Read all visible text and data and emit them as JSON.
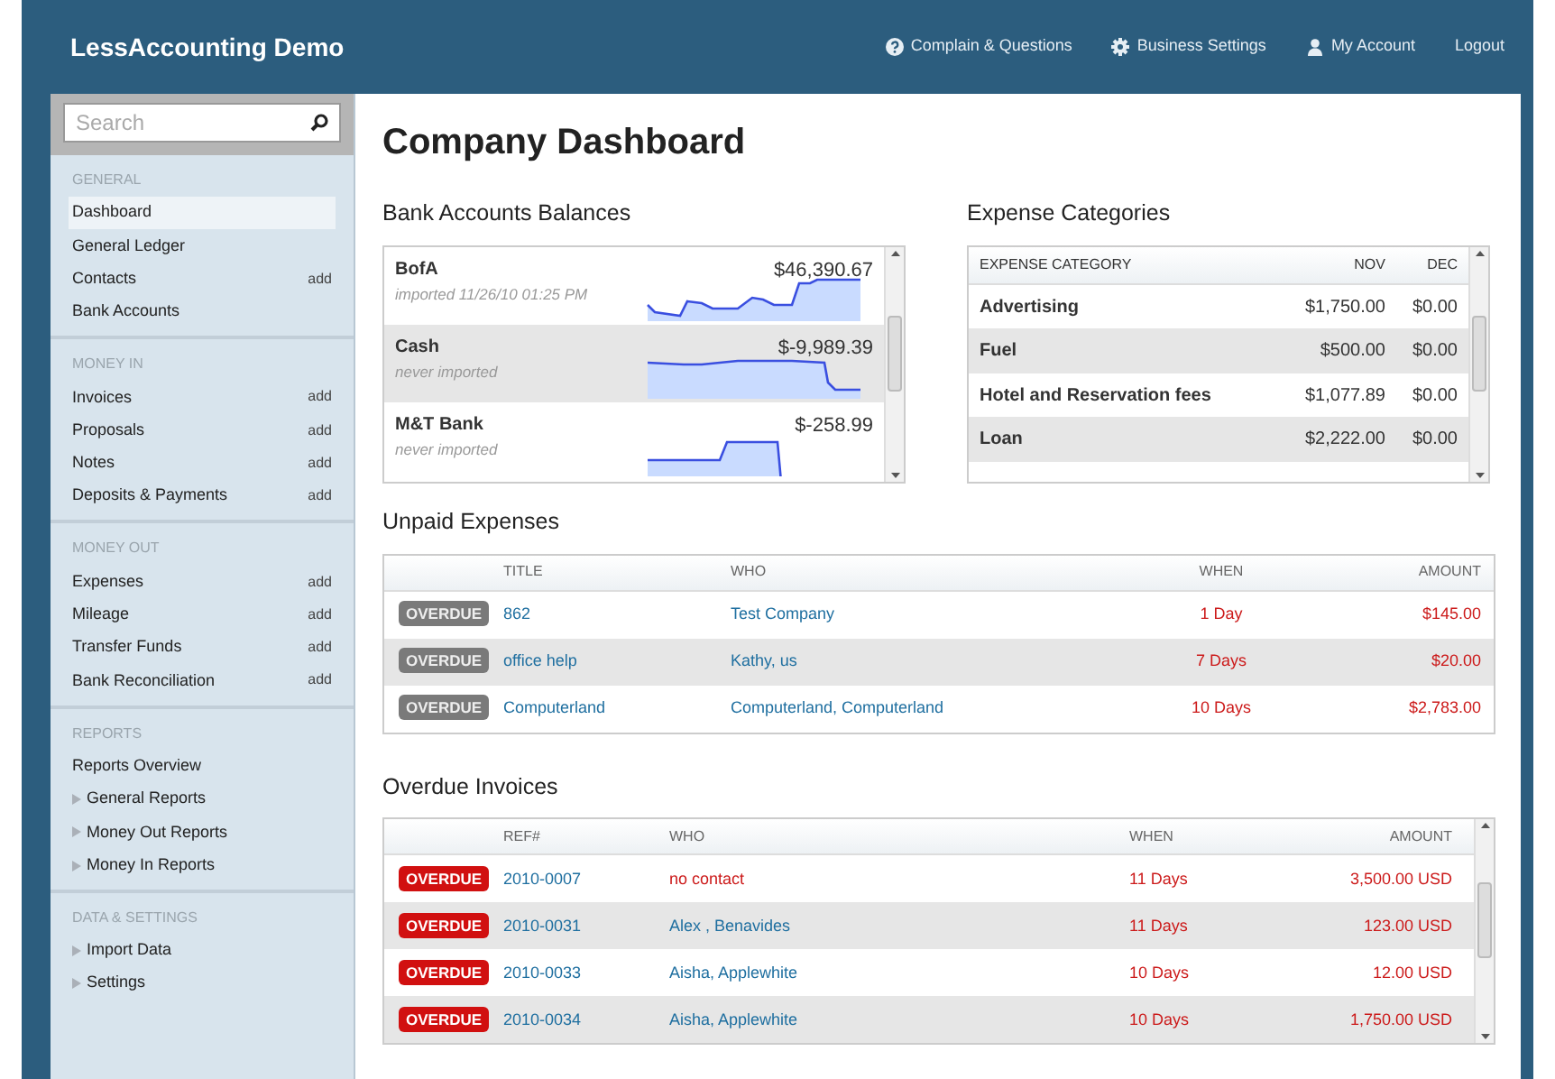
{
  "header": {
    "app_title": "LessAccounting Demo",
    "links": [
      {
        "label": "Complain & Questions",
        "kind": "help"
      },
      {
        "label": "Business Settings",
        "kind": "gear"
      },
      {
        "label": "My Account",
        "kind": "user"
      },
      {
        "label": "Logout",
        "kind": "plain"
      }
    ]
  },
  "sidebar": {
    "search": {
      "placeholder": "Search"
    },
    "sections": [
      {
        "title": "GENERAL",
        "items": [
          {
            "label": "Dashboard",
            "selected": true
          },
          {
            "label": "General Ledger",
            "selected": false
          },
          {
            "label": "Contacts",
            "selected": false,
            "add": "add"
          },
          {
            "label": "Bank Accounts",
            "selected": false
          }
        ]
      },
      {
        "title": "MONEY IN",
        "items": [
          {
            "label": "Invoices",
            "selected": false,
            "add": "add"
          },
          {
            "label": "Proposals",
            "selected": false,
            "add": "add"
          },
          {
            "label": "Notes",
            "selected": false,
            "add": "add"
          },
          {
            "label": "Deposits & Payments",
            "selected": false,
            "add": "add"
          }
        ]
      },
      {
        "title": "MONEY OUT",
        "items": [
          {
            "label": "Expenses",
            "selected": false,
            "add": "add"
          },
          {
            "label": "Mileage",
            "selected": false,
            "add": "add"
          },
          {
            "label": "Transfer Funds",
            "selected": false,
            "add": "add"
          },
          {
            "label": "Bank Reconciliation",
            "selected": false,
            "add": "add"
          }
        ]
      },
      {
        "title": "REPORTS",
        "items": [
          {
            "label": "Reports Overview",
            "selected": false
          },
          {
            "label": "General Reports",
            "selected": false,
            "expanded": false
          },
          {
            "label": "Money Out Reports",
            "selected": false,
            "expanded": false
          },
          {
            "label": "Money In Reports",
            "selected": false,
            "expanded": false
          }
        ]
      },
      {
        "title": "DATA & SETTINGS",
        "items": [
          {
            "label": "Import Data",
            "selected": false,
            "expanded": false
          },
          {
            "label": "Settings",
            "selected": false,
            "expanded": false
          }
        ]
      }
    ]
  },
  "page_title": "Company Dashboard",
  "bank_accounts": {
    "title": "Bank Accounts Balances",
    "accounts": [
      {
        "name": "BofA",
        "status": "imported 11/26/10 01:25 PM",
        "balance": "$46,390.67"
      },
      {
        "name": "Cash",
        "status": "never imported",
        "balance": "$-9,989.39"
      },
      {
        "name": "M&T Bank",
        "status": "never imported",
        "balance": "$-258.99"
      }
    ]
  },
  "expense_categories": {
    "title": "Expense Categories",
    "columns": [
      "EXPENSE CATEGORY",
      "NOV",
      "DEC"
    ],
    "rows": [
      [
        "Advertising",
        "$1,750.00",
        "$0.00"
      ],
      [
        "Fuel",
        "$500.00",
        "$0.00"
      ],
      [
        "Hotel and Reservation fees",
        "$1,077.89",
        "$0.00"
      ],
      [
        "Loan",
        "$2,222.00",
        "$0.00"
      ]
    ]
  },
  "unpaid_expenses": {
    "title": "Unpaid Expenses",
    "columns": [
      "TITLE",
      "WHO",
      "WHEN",
      "AMOUNT"
    ],
    "rows": [
      {
        "badge": "OVERDUE",
        "title": "862",
        "who": "Test Company",
        "who_is_link": true,
        "when": "1 Day",
        "amount": "$145.00"
      },
      {
        "badge": "OVERDUE",
        "title": "office help",
        "who": "Kathy, us",
        "who_is_link": true,
        "when": "7 Days",
        "amount": "$20.00"
      },
      {
        "badge": "OVERDUE",
        "title": "Computerland",
        "who": "Computerland, Computerland",
        "who_is_link": true,
        "when": "10 Days",
        "amount": "$2,783.00"
      }
    ]
  },
  "overdue_invoices": {
    "title": "Overdue Invoices",
    "columns": [
      "REF#",
      "WHO",
      "WHEN",
      "AMOUNT"
    ],
    "rows": [
      {
        "badge": "OVERDUE",
        "title": "2010-0007",
        "who": "no contact",
        "who_is_link": false,
        "when": "11 Days",
        "amount": "3,500.00 USD"
      },
      {
        "badge": "OVERDUE",
        "title": "2010-0031",
        "who": "Alex , Benavides",
        "who_is_link": true,
        "when": "11 Days",
        "amount": "123.00 USD"
      },
      {
        "badge": "OVERDUE",
        "title": "2010-0033",
        "who": "Aisha, Applewhite",
        "who_is_link": true,
        "when": "10 Days",
        "amount": "12.00 USD"
      },
      {
        "badge": "OVERDUE",
        "title": "2010-0034",
        "who": "Aisha, Applewhite",
        "who_is_link": true,
        "when": "10 Days",
        "amount": "1,750.00 USD"
      }
    ]
  }
}
